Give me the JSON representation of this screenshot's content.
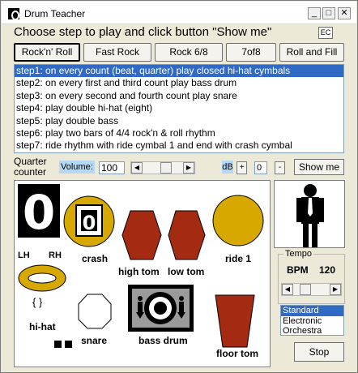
{
  "window": {
    "title": "Drum Teacher",
    "minimize_glyph": "_",
    "maximize_glyph": "□",
    "close_glyph": "✕"
  },
  "instruction": "Choose step to play and click button \"Show me\"",
  "lang_toggle": "EC",
  "style_buttons": [
    {
      "label": "Rock'n' Roll",
      "selected": true
    },
    {
      "label": "Fast Rock",
      "selected": false
    },
    {
      "label": "Rock 6/8",
      "selected": false
    },
    {
      "label": "7of8",
      "selected": false
    },
    {
      "label": "Roll and Fill",
      "selected": false
    }
  ],
  "steps": [
    "step1: on every count (beat, quarter) play closed hi-hat cymbals",
    "step2: on every first and third count play bass drum",
    "step3: on every second and fourth count play snare",
    "step4: play double hi-hat (eight)",
    "step5: play double bass",
    "step6: play two bars of 4/4 rock'n & roll rhythm",
    "step7: ride rhythm with ride cymbal 1 and end with crash cymbal"
  ],
  "selected_step": 0,
  "controls": {
    "quarter_counter_label": "Quarter counter",
    "volume_label": "Volume:",
    "volume_value": "100",
    "volume_level": 0.6,
    "db_label": "dB",
    "plus": "+",
    "db_value": "0",
    "minus": "-",
    "show_me": "Show me"
  },
  "counter_display": "0",
  "drum_labels": {
    "lh": "LH",
    "rh": "RH",
    "crash": "crash",
    "crash_digit": "0",
    "high_tom": "high tom",
    "low_tom": "low tom",
    "ride": "ride 1",
    "hi_hat": "hi-hat",
    "hihat_pedal": "{ }",
    "snare": "snare",
    "bass_drum": "bass drum",
    "floor_tom": "floor tom"
  },
  "tempo": {
    "group_label": "Tempo",
    "bpm_label": "BPM",
    "bpm_value": "120",
    "slider_level": 0.25
  },
  "sound_sets": [
    "Standard",
    "Electronic",
    "Orchestra"
  ],
  "selected_sound_set": 0,
  "stop_label": "Stop",
  "colors": {
    "cymbal_gold": "#d7a800",
    "tom_red": "#a52a12",
    "selection_blue": "#316ac5",
    "label_bg_blue": "#b5d9f5"
  }
}
